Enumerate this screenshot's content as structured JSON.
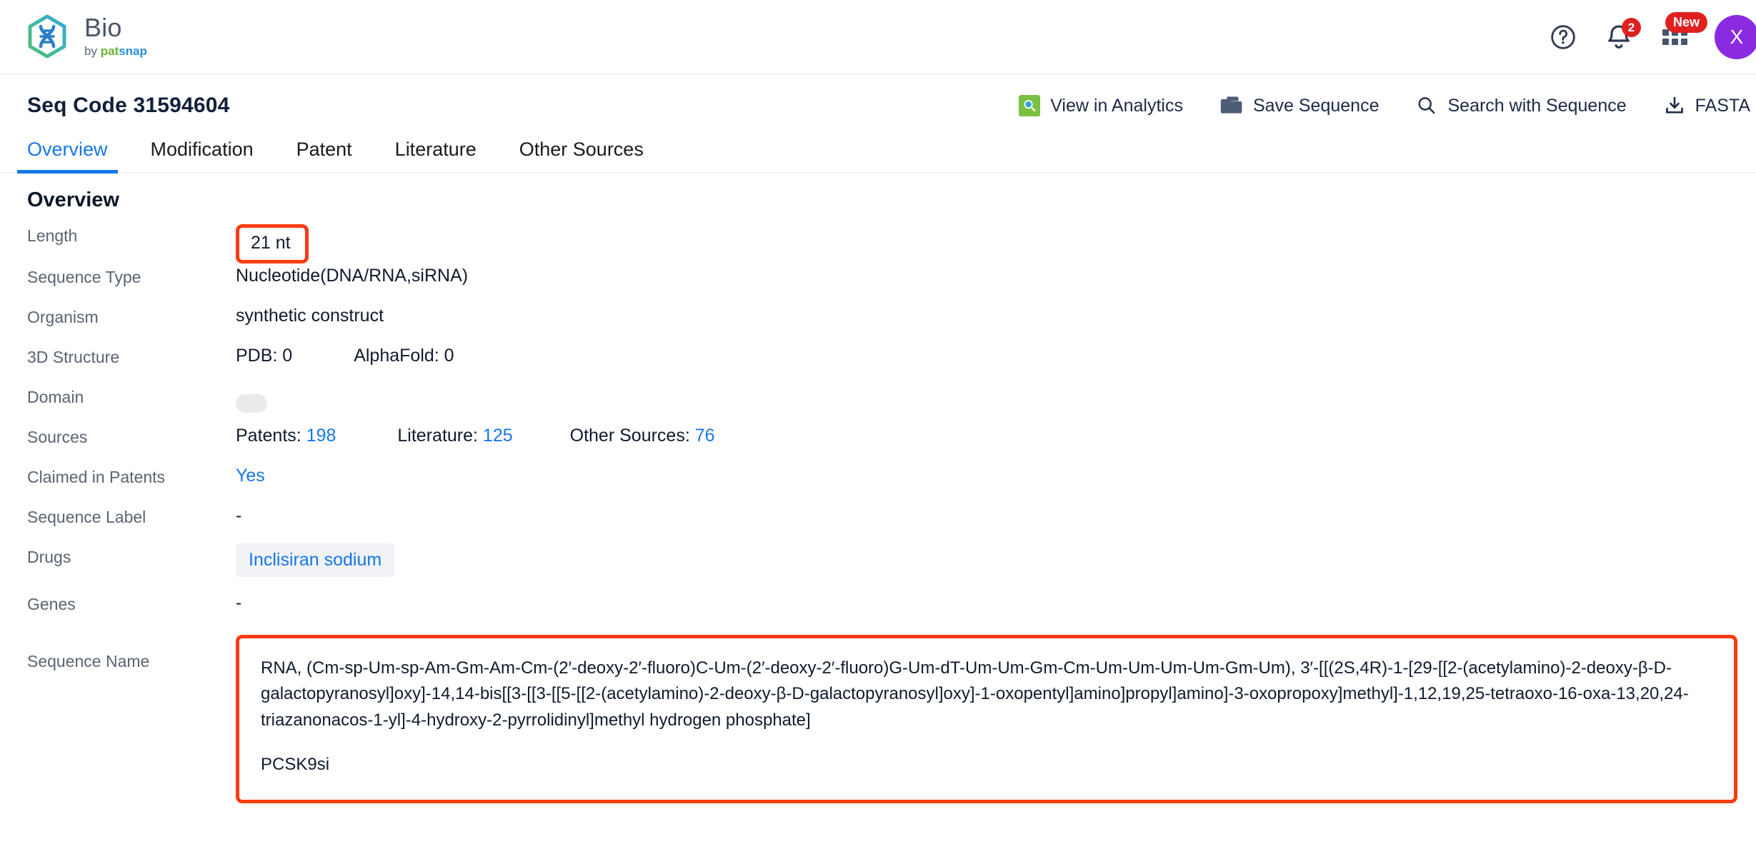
{
  "brand": {
    "title": "Bio",
    "by": "by ",
    "pat": "pat",
    "snap": "snap",
    "logo_icon": "dna-hexagon-logo"
  },
  "topbar": {
    "help_icon": "help-circle-icon",
    "notifications_icon": "bell-icon",
    "notifications_count": "2",
    "apps_icon": "apps-grid-icon",
    "apps_badge": "New",
    "avatar_initial": "X",
    "avatar_color": "#8a2be2",
    "badge_color": "#e02020"
  },
  "header": {
    "seq_code": "Seq Code 31594604",
    "actions": [
      {
        "label": "View in Analytics",
        "icon": "analytics-magnifier-icon"
      },
      {
        "label": "Save Sequence",
        "icon": "folder-icon"
      },
      {
        "label": "Search with Sequence",
        "icon": "search-icon"
      },
      {
        "label": "FASTA",
        "icon": "download-icon"
      }
    ]
  },
  "tabs": [
    {
      "label": "Overview",
      "active": true
    },
    {
      "label": "Modification",
      "active": false
    },
    {
      "label": "Patent",
      "active": false
    },
    {
      "label": "Literature",
      "active": false
    },
    {
      "label": "Other Sources",
      "active": false
    }
  ],
  "overview": {
    "section_title": "Overview",
    "labels": {
      "length": "Length",
      "sequence_type": "Sequence Type",
      "organism": "Organism",
      "structure_3d": "3D Structure",
      "domain": "Domain",
      "sources": "Sources",
      "claimed_in_patents": "Claimed in Patents",
      "sequence_label": "Sequence Label",
      "drugs": "Drugs",
      "genes": "Genes",
      "sequence_name": "Sequence Name"
    },
    "values": {
      "length": "21 nt",
      "sequence_type": "Nucleotide(DNA/RNA,siRNA)",
      "organism": "synthetic construct",
      "pdb_label": "PDB: 0",
      "alphafold_label": "AlphaFold: 0",
      "domain": "",
      "patents_label": "Patents:",
      "patents_count": "198",
      "literature_label": "Literature:",
      "literature_count": "125",
      "other_sources_label": "Other Sources:",
      "other_sources_count": "76",
      "claimed_in_patents": "Yes",
      "sequence_label": "-",
      "drug_chip": "Inclisiran sodium",
      "genes": "-",
      "sequence_name_line1": "RNA, (Cm-sp-Um-sp-Am-Gm-Am-Cm-(2′-deoxy-2′-fluoro)C-Um-(2′-deoxy-2′-fluoro)G-Um-dT-Um-Um-Gm-Cm-Um-Um-Um-Um-Gm-Um), 3′-[[(2S,4R)-1-[29-[[2-(acetylamino)-2-deoxy-β-D-galactopyranosyl]oxy]-14,14-bis[[3-[[3-[[5-[[2-(acetylamino)-2-deoxy-β-D-galactopyranosyl]oxy]-1-oxopentyl]amino]propyl]amino]-3-oxopropoxy]methyl]-1,12,19,25-tetraoxo-16-oxa-13,20,24-triazanonacos-1-yl]-4-hydroxy-2-pyrrolidinyl]methyl hydrogen phosphate]",
      "sequence_name_line2": "PCSK9si"
    },
    "highlight_color": "#fa3c11",
    "link_color": "#1876e8"
  }
}
